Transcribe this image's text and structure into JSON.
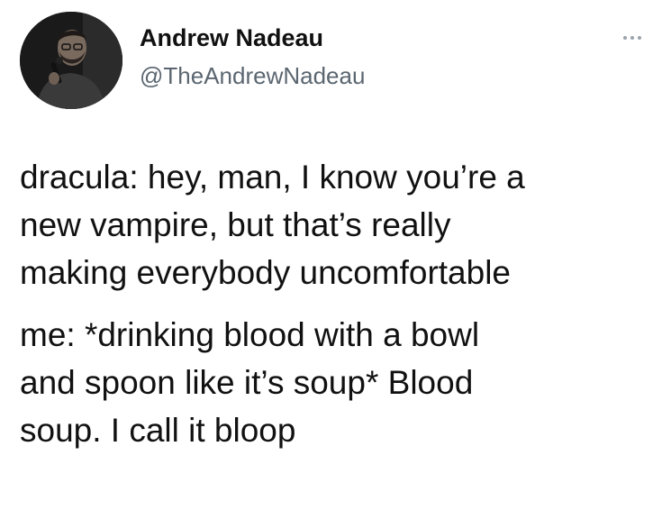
{
  "author": {
    "display_name": "Andrew Nadeau",
    "handle": "@TheAndrewNadeau",
    "avatar_icon": "profile-photo"
  },
  "menu_icon": "more-options-icon",
  "tweet": {
    "paragraphs": [
      "dracula: hey, man, I know you’re a\nnew vampire, but that’s really\nmaking everybody uncomfortable",
      "me: *drinking blood with a bowl\nand spoon like it’s soup* Blood\nsoup. I call it bloop"
    ]
  },
  "colors": {
    "text": "#111111",
    "handle": "#5b6670",
    "background": "#ffffff"
  }
}
